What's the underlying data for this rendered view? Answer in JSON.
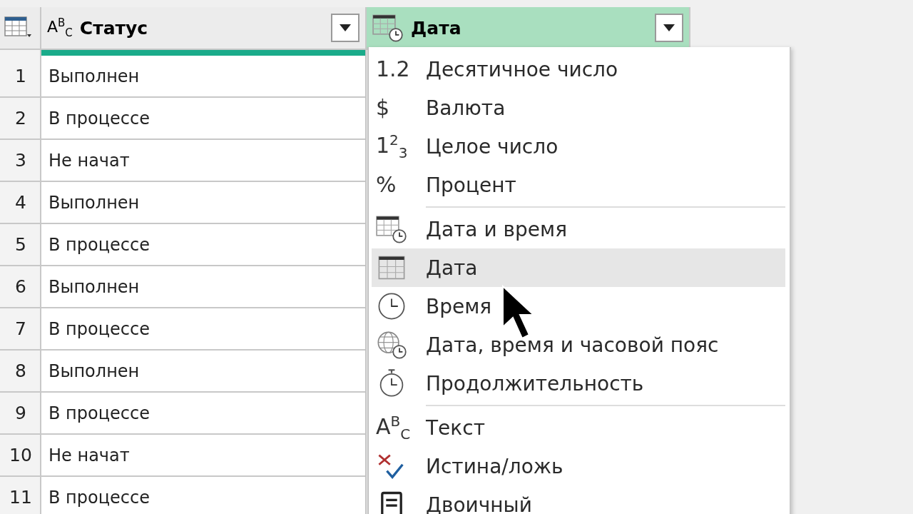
{
  "table": {
    "columns": [
      {
        "kind": "text",
        "icon_text": "A$^{B}$$_{C}$",
        "name": "Статус",
        "selected": false
      },
      {
        "kind": "datetime",
        "name": "Дата",
        "selected": true
      }
    ],
    "rows": [
      {
        "number": "1",
        "status": "Выполнен"
      },
      {
        "number": "2",
        "status": "В процессе"
      },
      {
        "number": "3",
        "status": "Не начат"
      },
      {
        "number": "4",
        "status": "Выполнен"
      },
      {
        "number": "5",
        "status": "В процессе"
      },
      {
        "number": "6",
        "status": "Выполнен"
      },
      {
        "number": "7",
        "status": "В процессе"
      },
      {
        "number": "8",
        "status": "Выполнен"
      },
      {
        "number": "9",
        "status": "В процессе"
      },
      {
        "number": "10",
        "status": "Не начат"
      },
      {
        "number": "11",
        "status": "В процессе"
      }
    ]
  },
  "type_menu": {
    "groups": [
      [
        {
          "kind": "glyph",
          "icon_text": "1.2",
          "label": "Десятичное число",
          "selected": false
        },
        {
          "kind": "glyph",
          "icon_text": "$",
          "label": "Валюта",
          "selected": false
        },
        {
          "kind": "glyph",
          "icon_text": "1$^{2}$$_{3}$",
          "label": "Целое число",
          "selected": false
        },
        {
          "kind": "glyph",
          "icon_text": "%",
          "label": "Процент",
          "selected": false
        }
      ],
      [
        {
          "kind": "datetime",
          "label": "Дата и время",
          "selected": false
        },
        {
          "kind": "date",
          "label": "Дата",
          "selected": true
        },
        {
          "kind": "time",
          "label": "Время",
          "selected": false
        },
        {
          "kind": "datetimezone",
          "label": "Дата, время и часовой пояс",
          "selected": false
        },
        {
          "kind": "duration",
          "label": "Продолжительность",
          "selected": false
        }
      ],
      [
        {
          "kind": "glyph",
          "icon_text": "A$^{B}$$_{C}$",
          "label": "Текст",
          "selected": false
        },
        {
          "kind": "boolean",
          "label": "Истина/ложь",
          "selected": false
        },
        {
          "kind": "binary",
          "label": "Двоичный",
          "selected": false
        }
      ]
    ]
  }
}
